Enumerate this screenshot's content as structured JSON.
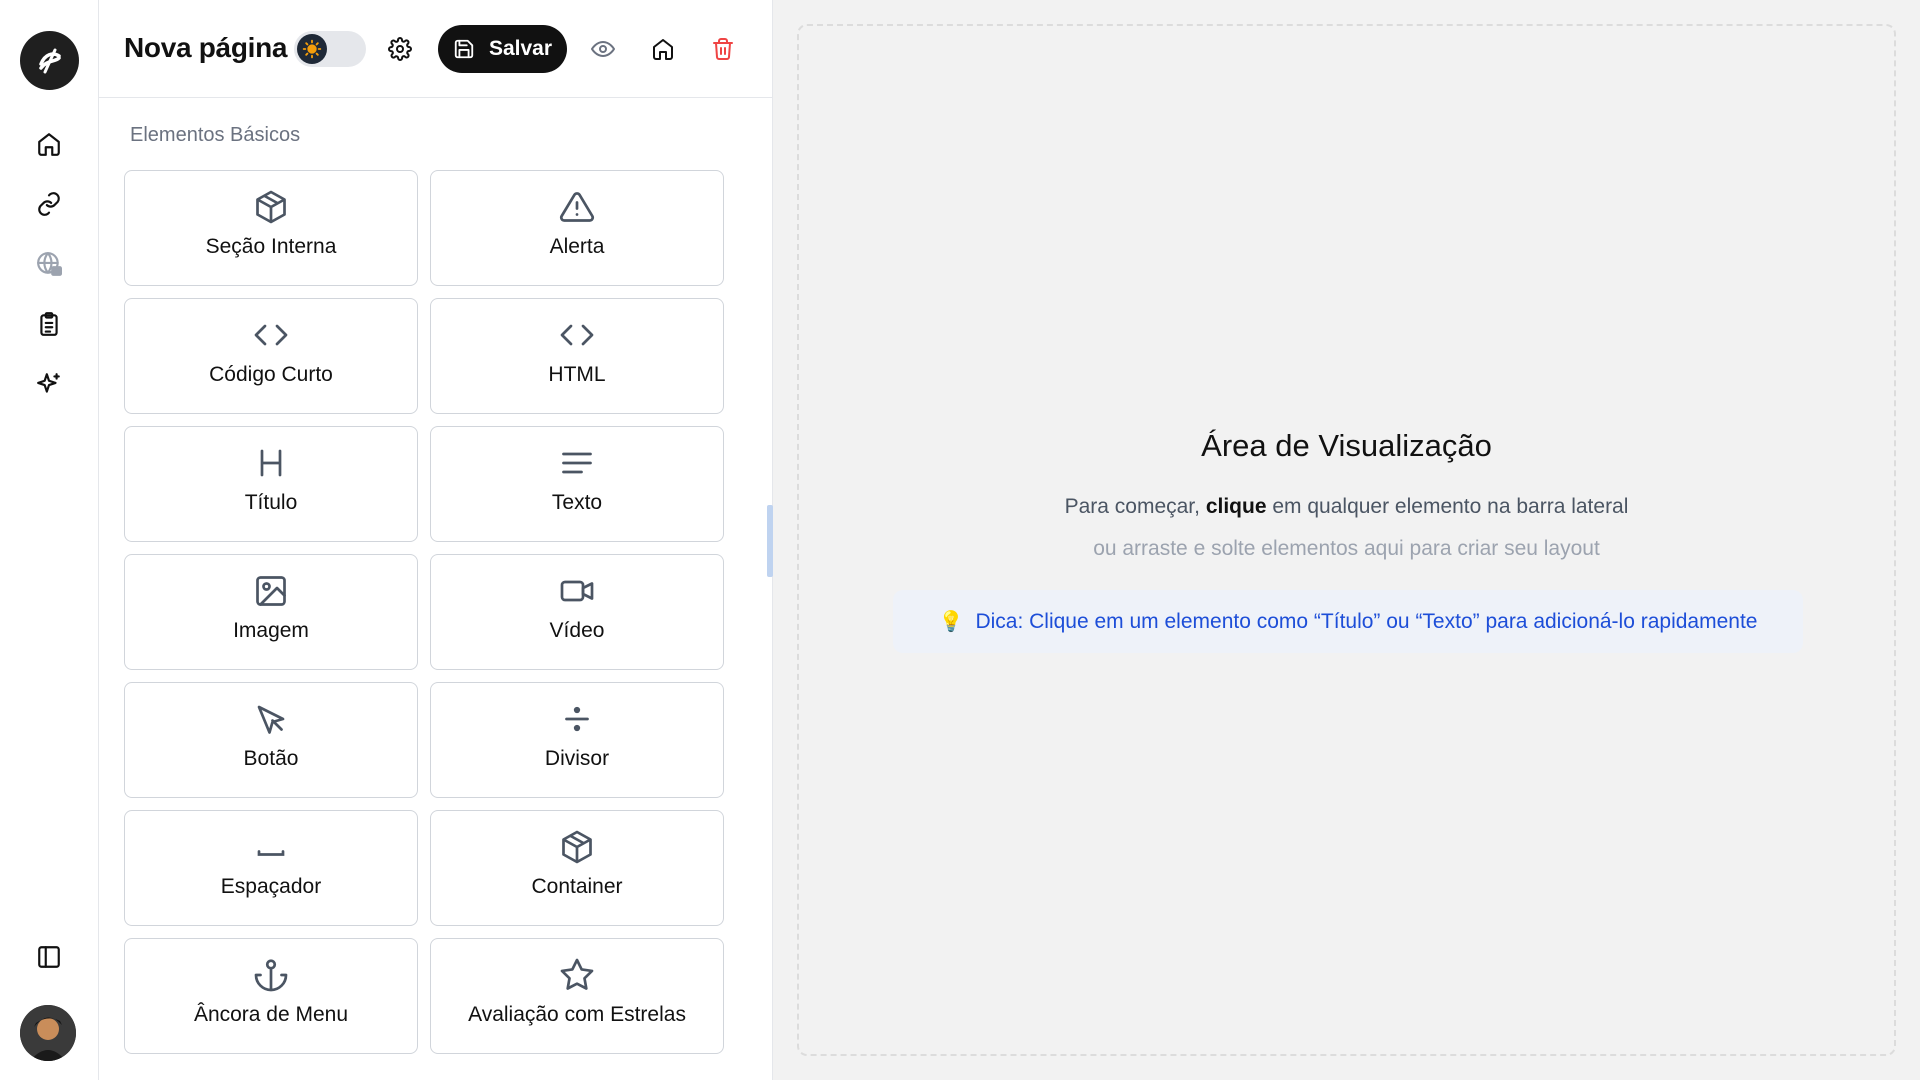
{
  "page": {
    "title": "Nova página",
    "save_label": "Salvar"
  },
  "rail": {
    "items": [
      "home-icon",
      "link-icon",
      "globe-lock-icon",
      "clipboard-icon",
      "sparkles-icon"
    ],
    "bottom": [
      "sidebar-toggle-icon"
    ]
  },
  "toolbar": {
    "icons": [
      "settings-icon",
      "save-icon",
      "eye-icon",
      "home-icon",
      "trash-icon"
    ],
    "danger_color": "#ef4444"
  },
  "panel": {
    "section_title": "Elementos Básicos",
    "elements": [
      {
        "label": "Seção Interna",
        "icon": "box-icon"
      },
      {
        "label": "Alerta",
        "icon": "alert-triangle-icon"
      },
      {
        "label": "Código Curto",
        "icon": "code-icon"
      },
      {
        "label": "HTML",
        "icon": "code-icon"
      },
      {
        "label": "Título",
        "icon": "heading-icon"
      },
      {
        "label": "Texto",
        "icon": "text-align-icon"
      },
      {
        "label": "Imagem",
        "icon": "image-icon"
      },
      {
        "label": "Vídeo",
        "icon": "video-icon"
      },
      {
        "label": "Botão",
        "icon": "pointer-icon"
      },
      {
        "label": "Divisor",
        "icon": "divide-icon"
      },
      {
        "label": "Espaçador",
        "icon": "space-icon"
      },
      {
        "label": "Container",
        "icon": "box-icon"
      },
      {
        "label": "Âncora de Menu",
        "icon": "anchor-icon"
      },
      {
        "label": "Avaliação com Estrelas",
        "icon": "star-icon"
      }
    ]
  },
  "canvas": {
    "title": "Área de Visualização",
    "line1_prefix": "Para começar,",
    "line1_bold": "clique",
    "line1_suffix": "em qualquer elemento na barra lateral",
    "line2": "ou arraste e solte elementos aqui para criar seu layout",
    "tip": "Dica: Clique em um elemento como “Título” ou “Texto” para adicioná-lo rapidamente",
    "tip_icon": "lightbulb-icon",
    "tip_color": "#1d4ed8"
  }
}
